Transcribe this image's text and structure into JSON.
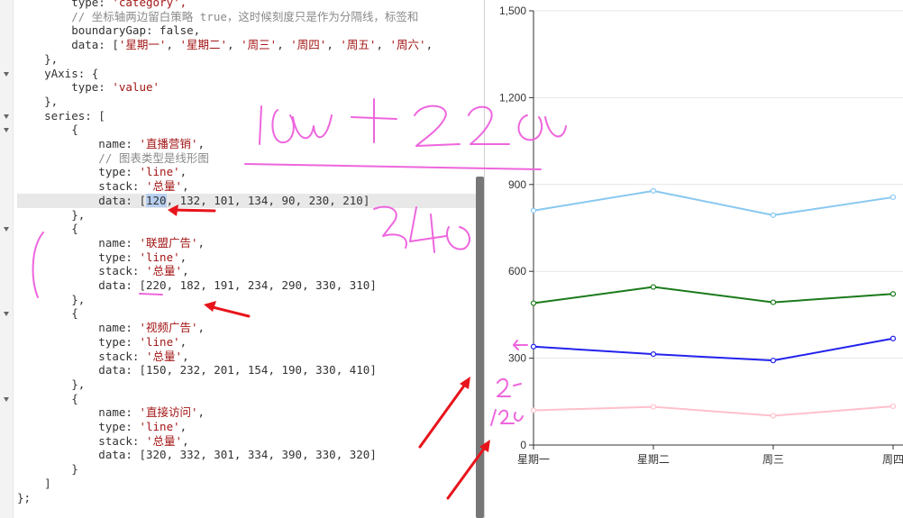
{
  "code_lines": [
    {
      "segments": [
        {
          "t": "        type: ",
          "c": "k"
        },
        {
          "t": "'category',",
          "c": "s"
        }
      ]
    },
    {
      "segments": [
        {
          "t": "        // 坐标轴两边留白策略 true，这时候刻度只是作为分隔线，标签和",
          "c": "c"
        }
      ]
    },
    {
      "segments": [
        {
          "t": "        boundaryGap: ",
          "c": "k"
        },
        {
          "t": "false,",
          "c": "n"
        }
      ]
    },
    {
      "segments": [
        {
          "t": "        data: [",
          "c": "k"
        },
        {
          "t": "'星期一'",
          "c": "s"
        },
        {
          "t": ", ",
          "c": "k"
        },
        {
          "t": "'星期二'",
          "c": "s"
        },
        {
          "t": ", ",
          "c": "k"
        },
        {
          "t": "'周三'",
          "c": "s"
        },
        {
          "t": ", ",
          "c": "k"
        },
        {
          "t": "'周四'",
          "c": "s"
        },
        {
          "t": ", ",
          "c": "k"
        },
        {
          "t": "'周五'",
          "c": "s"
        },
        {
          "t": ", ",
          "c": "k"
        },
        {
          "t": "'周六'",
          "c": "s"
        },
        {
          "t": ",",
          "c": "k"
        }
      ]
    },
    {
      "segments": [
        {
          "t": "    },",
          "c": "k"
        }
      ]
    },
    {
      "segments": [
        {
          "t": "    yAxis: {",
          "c": "k"
        }
      ]
    },
    {
      "segments": [
        {
          "t": "        type: ",
          "c": "k"
        },
        {
          "t": "'value'",
          "c": "s"
        }
      ]
    },
    {
      "segments": [
        {
          "t": "    },",
          "c": "k"
        }
      ]
    },
    {
      "segments": [
        {
          "t": "    series: [",
          "c": "k"
        }
      ]
    },
    {
      "segments": [
        {
          "t": "        {",
          "c": "k"
        }
      ]
    },
    {
      "segments": [
        {
          "t": "            name: ",
          "c": "k"
        },
        {
          "t": "'直播营销'",
          "c": "s"
        },
        {
          "t": ",",
          "c": "k"
        }
      ]
    },
    {
      "segments": [
        {
          "t": "            // 图表类型是线形图",
          "c": "c"
        }
      ]
    },
    {
      "segments": [
        {
          "t": "            type: ",
          "c": "k"
        },
        {
          "t": "'line'",
          "c": "s"
        },
        {
          "t": ",",
          "c": "k"
        }
      ]
    },
    {
      "segments": [
        {
          "t": "            stack: ",
          "c": "k"
        },
        {
          "t": "'总量'",
          "c": "s"
        },
        {
          "t": ",",
          "c": "k"
        }
      ]
    },
    {
      "segments": [
        {
          "t": "            data: [",
          "c": "k"
        },
        {
          "t": "120",
          "c": "sel"
        },
        {
          "t": ", 132, 101, 134, 90, 230, 210]",
          "c": "k"
        }
      ],
      "highlight": true
    },
    {
      "segments": [
        {
          "t": "        },",
          "c": "k"
        }
      ]
    },
    {
      "segments": [
        {
          "t": "        {",
          "c": "k"
        }
      ]
    },
    {
      "segments": [
        {
          "t": "            name: ",
          "c": "k"
        },
        {
          "t": "'联盟广告'",
          "c": "s"
        },
        {
          "t": ",",
          "c": "k"
        }
      ]
    },
    {
      "segments": [
        {
          "t": "            type: ",
          "c": "k"
        },
        {
          "t": "'line'",
          "c": "s"
        },
        {
          "t": ",",
          "c": "k"
        }
      ]
    },
    {
      "segments": [
        {
          "t": "            stack: ",
          "c": "k"
        },
        {
          "t": "'总量'",
          "c": "s"
        },
        {
          "t": ",",
          "c": "k"
        }
      ]
    },
    {
      "segments": [
        {
          "t": "            data: [220, 182, 191, 234, 290, 330, 310]",
          "c": "k"
        }
      ]
    },
    {
      "segments": [
        {
          "t": "        },",
          "c": "k"
        }
      ]
    },
    {
      "segments": [
        {
          "t": "        {",
          "c": "k"
        }
      ]
    },
    {
      "segments": [
        {
          "t": "            name: ",
          "c": "k"
        },
        {
          "t": "'视频广告'",
          "c": "s"
        },
        {
          "t": ",",
          "c": "k"
        }
      ]
    },
    {
      "segments": [
        {
          "t": "            type: ",
          "c": "k"
        },
        {
          "t": "'line'",
          "c": "s"
        },
        {
          "t": ",",
          "c": "k"
        }
      ]
    },
    {
      "segments": [
        {
          "t": "            stack: ",
          "c": "k"
        },
        {
          "t": "'总量'",
          "c": "s"
        },
        {
          "t": ",",
          "c": "k"
        }
      ]
    },
    {
      "segments": [
        {
          "t": "            data: [150, 232, 201, 154, 190, 330, 410]",
          "c": "k"
        }
      ]
    },
    {
      "segments": [
        {
          "t": "        },",
          "c": "k"
        }
      ]
    },
    {
      "segments": [
        {
          "t": "        {",
          "c": "k"
        }
      ]
    },
    {
      "segments": [
        {
          "t": "            name: ",
          "c": "k"
        },
        {
          "t": "'直接访问'",
          "c": "s"
        },
        {
          "t": ",",
          "c": "k"
        }
      ]
    },
    {
      "segments": [
        {
          "t": "            type: ",
          "c": "k"
        },
        {
          "t": "'line'",
          "c": "s"
        },
        {
          "t": ",",
          "c": "k"
        }
      ]
    },
    {
      "segments": [
        {
          "t": "            stack: ",
          "c": "k"
        },
        {
          "t": "'总量'",
          "c": "s"
        },
        {
          "t": ",",
          "c": "k"
        }
      ]
    },
    {
      "segments": [
        {
          "t": "            data: [320, 332, 301, 334, 390, 330, 320]",
          "c": "k"
        }
      ]
    },
    {
      "segments": [
        {
          "t": "        }",
          "c": "k"
        }
      ]
    },
    {
      "segments": [
        {
          "t": "    ]",
          "c": "k"
        }
      ]
    },
    {
      "segments": [
        {
          "t": "};",
          "c": "k"
        }
      ]
    }
  ],
  "fold_lines": [
    5,
    8,
    9,
    16,
    22,
    28
  ],
  "chart_data": {
    "type": "line",
    "stacked": true,
    "categories": [
      "星期一",
      "星期二",
      "周三",
      "周四"
    ],
    "yticks": [
      0,
      300,
      600,
      900,
      1200,
      1500
    ],
    "ytick_labels": [
      "0",
      "300",
      "600",
      "900",
      "1,200",
      "1,500"
    ],
    "ylim": [
      0,
      1500
    ],
    "grid": true,
    "series": [
      {
        "values": [
          120,
          132,
          101,
          134
        ],
        "color": "#ffc0cb"
      },
      {
        "values": [
          340,
          314,
          292,
          368
        ],
        "color": "#2222ee"
      },
      {
        "values": [
          490,
          546,
          493,
          522
        ],
        "color": "#1a7a1a"
      },
      {
        "values": [
          810,
          878,
          794,
          856
        ],
        "color": "#88c8f0"
      }
    ]
  },
  "annotations": {
    "handwritten": [
      "120+220",
      "340",
      "220",
      "120"
    ],
    "ink_color": "#ee66dd",
    "arrow_color": "#e8141b"
  }
}
